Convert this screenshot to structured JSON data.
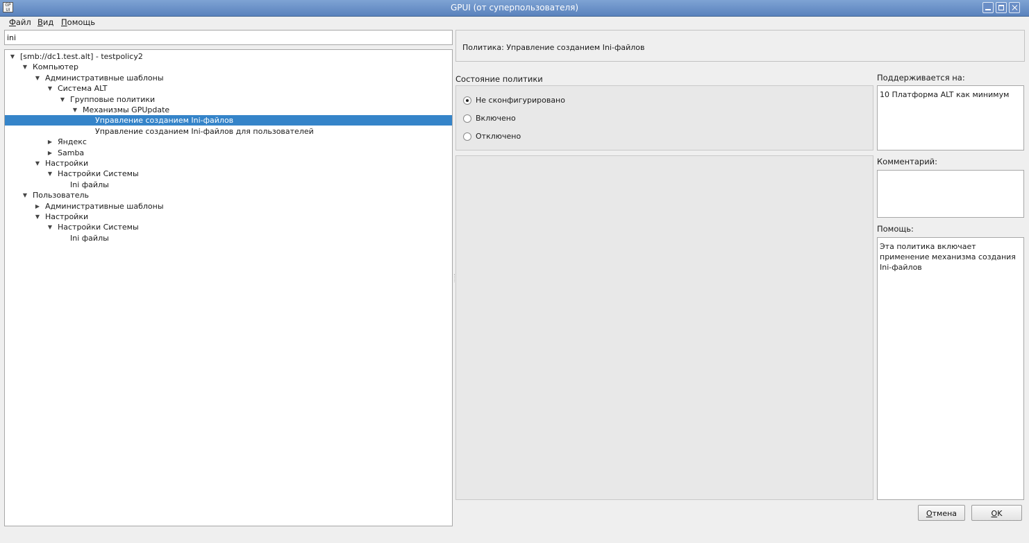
{
  "window": {
    "title": "GPUI (от суперпользователя)",
    "app_icon_text": "GP UI"
  },
  "menu": [
    "Файл",
    "Вид",
    "Помощь"
  ],
  "search": {
    "value": "ini"
  },
  "tree": [
    {
      "label": "[smb://dc1.test.alt] - testpolicy2",
      "depth": 0,
      "expander": "expanded",
      "selected": false
    },
    {
      "label": "Компьютер",
      "depth": 1,
      "expander": "expanded",
      "selected": false
    },
    {
      "label": "Административные шаблоны",
      "depth": 2,
      "expander": "expanded",
      "selected": false
    },
    {
      "label": "Система ALT",
      "depth": 3,
      "expander": "expanded",
      "selected": false
    },
    {
      "label": "Групповые политики",
      "depth": 4,
      "expander": "expanded",
      "selected": false
    },
    {
      "label": "Механизмы GPUpdate",
      "depth": 5,
      "expander": "expanded",
      "selected": false
    },
    {
      "label": "Управление созданием Ini-файлов",
      "depth": 6,
      "expander": "none",
      "selected": true
    },
    {
      "label": "Управление созданием Ini-файлов для пользователей",
      "depth": 6,
      "expander": "none",
      "selected": false
    },
    {
      "label": "Яндекс",
      "depth": 3,
      "expander": "collapsed",
      "selected": false
    },
    {
      "label": "Samba",
      "depth": 3,
      "expander": "collapsed",
      "selected": false
    },
    {
      "label": "Настройки",
      "depth": 2,
      "expander": "expanded",
      "selected": false
    },
    {
      "label": "Настройки Системы",
      "depth": 3,
      "expander": "expanded",
      "selected": false
    },
    {
      "label": "Ini файлы",
      "depth": 4,
      "expander": "none",
      "selected": false
    },
    {
      "label": "Пользователь",
      "depth": 1,
      "expander": "expanded",
      "selected": false
    },
    {
      "label": "Административные шаблоны",
      "depth": 2,
      "expander": "collapsed",
      "selected": false
    },
    {
      "label": "Настройки",
      "depth": 2,
      "expander": "expanded",
      "selected": false
    },
    {
      "label": "Настройки Системы",
      "depth": 3,
      "expander": "expanded",
      "selected": false
    },
    {
      "label": "Ini файлы",
      "depth": 4,
      "expander": "none",
      "selected": false
    }
  ],
  "policy": {
    "header": "Политика: Управление созданием Ini-файлов",
    "state_label": "Состояние политики",
    "options": [
      {
        "label": "Не сконфигурировано",
        "checked": true
      },
      {
        "label": "Включено",
        "checked": false
      },
      {
        "label": "Отключено",
        "checked": false
      }
    ]
  },
  "side": {
    "supported_label": "Поддерживается на:",
    "supported_value": "10 Платформа ALT как минимум",
    "comment_label": "Комментарий:",
    "comment_value": "",
    "help_label": "Помощь:",
    "help_value": "Эта политика включает применение механизма создания Ini-файлов"
  },
  "buttons": {
    "cancel": "Отмена",
    "ok": "OK"
  },
  "colors": {
    "titlebar": "#5a82bd",
    "selection": "#3584c9"
  }
}
